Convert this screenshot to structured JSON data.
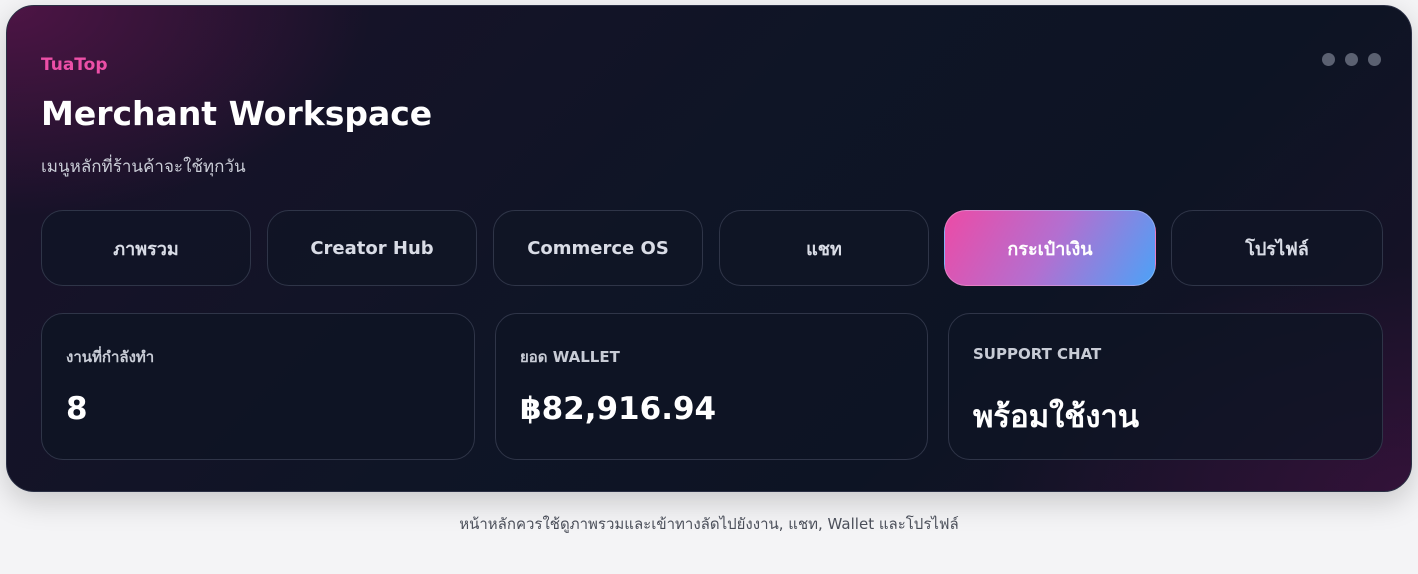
{
  "brand": "TuaTop",
  "title": "Merchant Workspace",
  "subtitle": "เมนูหลักที่ร้านค้าจะใช้ทุกวัน",
  "tabs": [
    {
      "label": "ภาพรวม"
    },
    {
      "label": "Creator Hub"
    },
    {
      "label": "Commerce OS"
    },
    {
      "label": "แชท"
    },
    {
      "label": "กระเป๋าเงิน"
    },
    {
      "label": "โปรไฟล์"
    }
  ],
  "active_tab": "กระเป๋าเงิน",
  "stats": [
    {
      "label": "งานที่กำลังทำ",
      "value": "8"
    },
    {
      "label": "ยอด WALLET",
      "value": "฿82,916.94"
    },
    {
      "label": "SUPPORT CHAT",
      "value": "พร้อมใช้งาน"
    }
  ],
  "footer_caption": "หน้าหลักควรใช้ดูภาพรวมและเข้าทางลัดไปยังงาน, แชท, Wallet และโปรไฟล์",
  "colors": {
    "brand": "#ec4fa7",
    "active_tab_gradient_start": "#ec4ba6",
    "active_tab_gradient_end": "#4ca2f7",
    "card_background": "#0f1526"
  },
  "icons": {
    "menu": "more-dots-icon"
  }
}
